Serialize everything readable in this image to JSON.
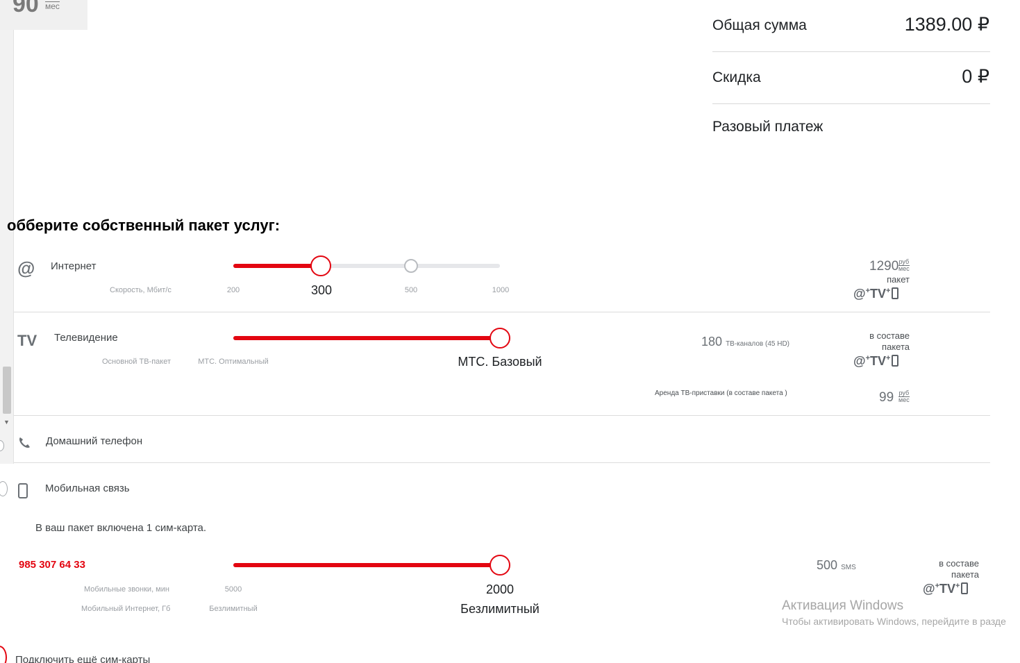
{
  "top_card": {
    "price": "90",
    "unit_top": "руб",
    "unit_bottom": "мес"
  },
  "summary": {
    "total_label": "Общая сумма",
    "total_value": "1389.00 ₽",
    "discount_label": "Скидка",
    "discount_value": "0 ₽",
    "onetime_label": "Разовый платеж"
  },
  "heading": "обберите собственный пакет услуг:",
  "internet": {
    "icon": "at-icon",
    "label": "Интернет",
    "sub_label": "Скорость, Мбит/с",
    "ticks": [
      "200",
      "300",
      "500",
      "1000"
    ],
    "selected": "300",
    "slider_fraction": 0.333,
    "price": "1290",
    "price_unit_top": "руб",
    "price_unit_bottom": "мес",
    "price_note": "пакет",
    "combo": {
      "at": "@",
      "plus1": "+",
      "tv": "TV",
      "plus2": "+"
    }
  },
  "tv": {
    "icon": "tv-icon",
    "label": "Телевидение",
    "sub_label": "Основной ТВ-пакет",
    "ticks": [
      "МТС. Оптимальный",
      "МТС. Базовый"
    ],
    "selected": "МТС. Базовый",
    "slider_fraction": 1.0,
    "channels_count": "180",
    "channels_note": "ТВ-каналов (45 HD)",
    "pkg_line1": "в составе",
    "pkg_line2": "пакета",
    "combo": {
      "at": "@",
      "plus1": "+",
      "tv": "TV",
      "plus2": "+"
    },
    "rent_label": "Аренда ТВ-приставки (в составе пакета )",
    "rent_price": "99",
    "rent_unit_top": "руб",
    "rent_unit_bottom": "мес"
  },
  "home_phone": {
    "icon": "phone-icon",
    "label": "Домашний телефон"
  },
  "mobile": {
    "icon": "mobile-icon",
    "label": "Мобильная связь",
    "included_text": "В ваш пакет включена 1 сим-карта.",
    "number": "985 307 64 33",
    "calls_label": "Мобильные звонки, мин",
    "internet_label": "Мобильный Интернет, Гб",
    "calls_tick_min": "5000",
    "internet_tick_min": "Безлимитный",
    "calls_selected": "2000",
    "internet_selected": "Безлимитный",
    "slider_fraction": 1.0,
    "sms_count": "500",
    "sms_unit": "SMS",
    "pkg_line1": "в составе",
    "pkg_line2": "пакета",
    "combo": {
      "at": "@",
      "plus1": "+",
      "tv": "TV",
      "plus2": "+"
    }
  },
  "add_sim": {
    "label": "Подключить ещё сим-карты"
  },
  "windows_watermark": {
    "title": "Активация Windows",
    "subtitle": "Чтобы активировать Windows, перейдите в разде"
  },
  "colors": {
    "accent": "#e30611",
    "track": "#e6e7ea",
    "divider": "#dcdcdc"
  }
}
